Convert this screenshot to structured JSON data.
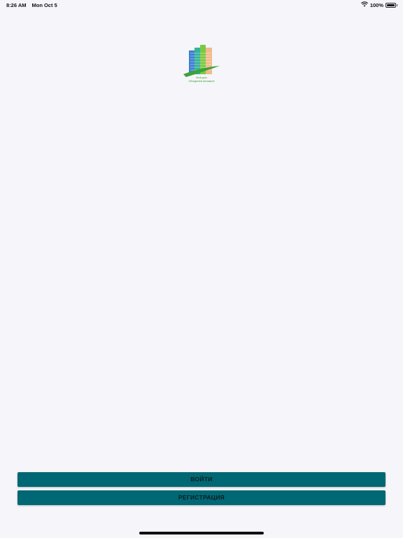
{
  "status_bar": {
    "time": "8:26 AM",
    "date": "Mon Oct 5",
    "battery_percent": "100%",
    "battery_level": 1.0
  },
  "logo": {
    "text_line1": "Мой дом",
    "text_line2": "Объединяем жилищные",
    "colors": {
      "blue": "#3f7fd1",
      "teal": "#34b39a",
      "green": "#7bc943",
      "peach": "#f2b98a",
      "swoosh": "#3aa33a"
    }
  },
  "actions": {
    "login_label": "ВОЙТИ",
    "register_label": "РЕГИСТРАЦИЯ",
    "button_color": "#006874"
  }
}
